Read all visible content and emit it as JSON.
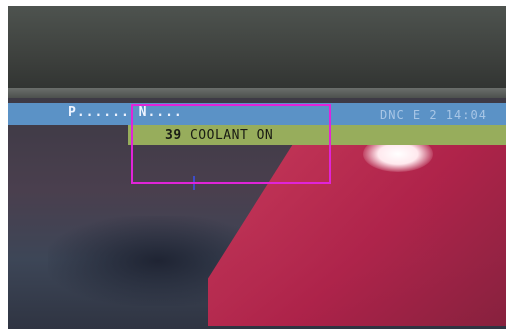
{
  "status_bar": {
    "program_label": "P...... N....",
    "mode_text": "DNC E 2 14:04"
  },
  "message": {
    "number": "39",
    "text": "COOLANT ON"
  },
  "colors": {
    "status_bar": "#5b92c6",
    "message_bar": "#97ad5c",
    "highlight": "#e024d8"
  }
}
